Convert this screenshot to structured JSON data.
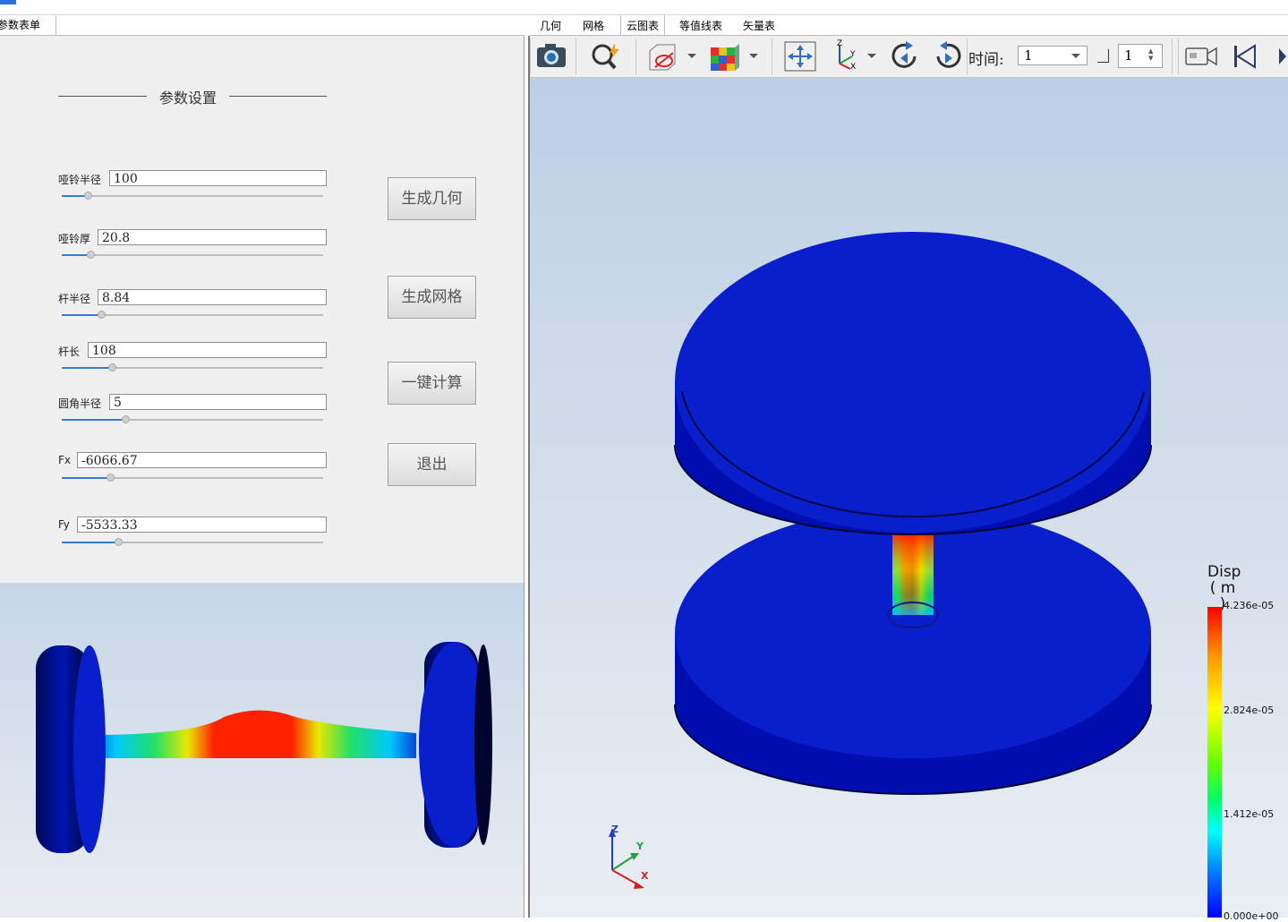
{
  "window": {
    "title": ""
  },
  "left_tabs": {
    "form_tab": "参数表单"
  },
  "form": {
    "section_title": "参数设置",
    "params": [
      {
        "label": "哑铃半径",
        "value": "100",
        "slider": 0.1
      },
      {
        "label": "哑铃厚",
        "value": "20.8",
        "slider": 0.11
      },
      {
        "label": "杆半径",
        "value": "8.84",
        "slider": 0.15
      },
      {
        "label": "杆长",
        "value": "108",
        "slider": 0.2
      },
      {
        "label": "圆角半径",
        "value": "5",
        "slider": 0.25
      },
      {
        "label": "Fx",
        "value": "-6066.67",
        "slider": 0.19
      },
      {
        "label": "Fy",
        "value": "-5533.33",
        "slider": 0.22
      }
    ],
    "buttons": {
      "generate_geometry": "生成几何",
      "generate_mesh": "生成网格",
      "compute": "一键计算",
      "exit": "退出"
    }
  },
  "right_tabs": [
    "几何",
    "网格",
    "云图表",
    "等值线表",
    "矢量表"
  ],
  "toolbar": {
    "time_label": "时间:",
    "time_value": "1",
    "step_value": "1",
    "icons": [
      "camera-icon",
      "zoom-fit-icon",
      "section-view-icon",
      "color-map-icon",
      "pan-icon",
      "axes-icon",
      "rotate-cw-icon",
      "rotate-ccw-icon",
      "record-video-icon",
      "first-frame-icon",
      "next-frame-icon"
    ]
  },
  "legend": {
    "title_line1": "Disp",
    "title_line2": "( m )",
    "max": "4.236e-05",
    "mid2": "2.824e-05",
    "mid1": "1.412e-05",
    "min": "0.000e+00"
  },
  "axes_triad": {
    "z": "Z",
    "y": "Y",
    "x": "X"
  },
  "colors": {
    "accent": "#3b79d8",
    "mesh_body": "#0a1fcc",
    "background_top": "#bcd0e5"
  }
}
